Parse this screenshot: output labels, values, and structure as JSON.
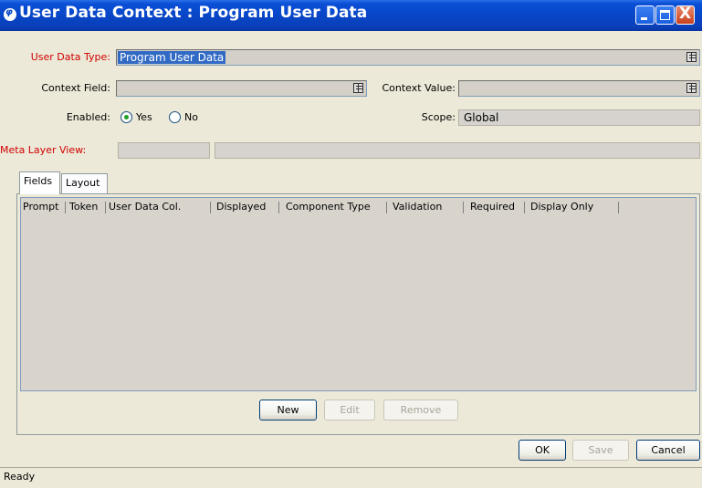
{
  "window": {
    "title": "User Data Context : Program User Data",
    "app_icon_glyph": "φ",
    "controls": {
      "minimize": "",
      "maximize": "",
      "close": "X"
    }
  },
  "form": {
    "user_data_type": {
      "label": "User Data Type:",
      "value": "Program User Data"
    },
    "context_field": {
      "label": "Context Field:",
      "value": ""
    },
    "context_value": {
      "label": "Context Value:",
      "value": ""
    },
    "enabled": {
      "label": "Enabled:",
      "options": [
        "Yes",
        "No"
      ],
      "selected": "Yes"
    },
    "scope": {
      "label": "Scope:",
      "value": "Global"
    },
    "meta_layer_view": {
      "label": "Meta Layer View:",
      "value1": "",
      "value2": ""
    }
  },
  "tabs": [
    {
      "label": "Fields",
      "active": true
    },
    {
      "label": "Layout",
      "active": false
    }
  ],
  "table": {
    "columns": [
      "Prompt",
      "Token",
      "User Data Col.",
      "Displayed",
      "Component Type",
      "Validation",
      "Required",
      "Display Only"
    ],
    "rows": []
  },
  "table_buttons": {
    "new": {
      "label": "New",
      "enabled": true
    },
    "edit": {
      "label": "Edit",
      "enabled": false
    },
    "remove": {
      "label": "Remove",
      "enabled": false
    }
  },
  "dialog_buttons": {
    "ok": {
      "label": "OK",
      "enabled": true
    },
    "save": {
      "label": "Save",
      "enabled": false
    },
    "cancel": {
      "label": "Cancel",
      "enabled": true
    }
  },
  "status_bar": {
    "text": "Ready"
  },
  "colors": {
    "required_label": "#d00000",
    "title_bar": "#0846c7",
    "selection": "#316ac5",
    "radio_dot": "#21a121"
  }
}
